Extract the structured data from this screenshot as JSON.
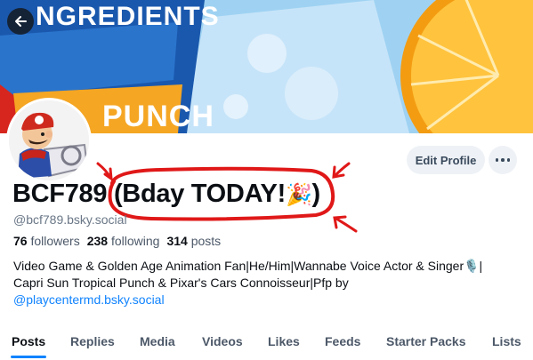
{
  "banner": {
    "text_top": "NGREDIENTS",
    "text_mid": "PUNCH",
    "colors": {
      "blue": "#1b5fb8",
      "orange": "#f7a21a",
      "sky": "#9fd2f2"
    }
  },
  "nav": {
    "back_icon": "arrow-left-icon"
  },
  "profile": {
    "display_name": "BCF789",
    "display_name_suffix": "(Bday TODAY!",
    "display_name_emoji": "🎉",
    "display_name_close": ")",
    "handle": "@bcf789.bsky.social",
    "followers_count": "76",
    "followers_label": "followers",
    "following_count": "238",
    "following_label": "following",
    "posts_count": "314",
    "posts_label": "posts",
    "bio_line1": "Video Game & Golden Age Animation Fan|He/Him|Wannabe Voice Actor & Singer🎙️|",
    "bio_line2": "Capri Sun Tropical Punch & Pixar's Cars Connoisseur|Pfp by",
    "bio_link": "@playcentermd.bsky.social"
  },
  "actions": {
    "edit_label": "Edit Profile",
    "more_icon": "ellipsis-icon"
  },
  "tabs": [
    {
      "label": "Posts",
      "active": true
    },
    {
      "label": "Replies"
    },
    {
      "label": "Media"
    },
    {
      "label": "Videos"
    },
    {
      "label": "Likes"
    },
    {
      "label": "Feeds"
    },
    {
      "label": "Starter Packs"
    },
    {
      "label": "Lists"
    }
  ],
  "theme": {
    "accent": "#1083fe",
    "annotation": "#e01818"
  }
}
